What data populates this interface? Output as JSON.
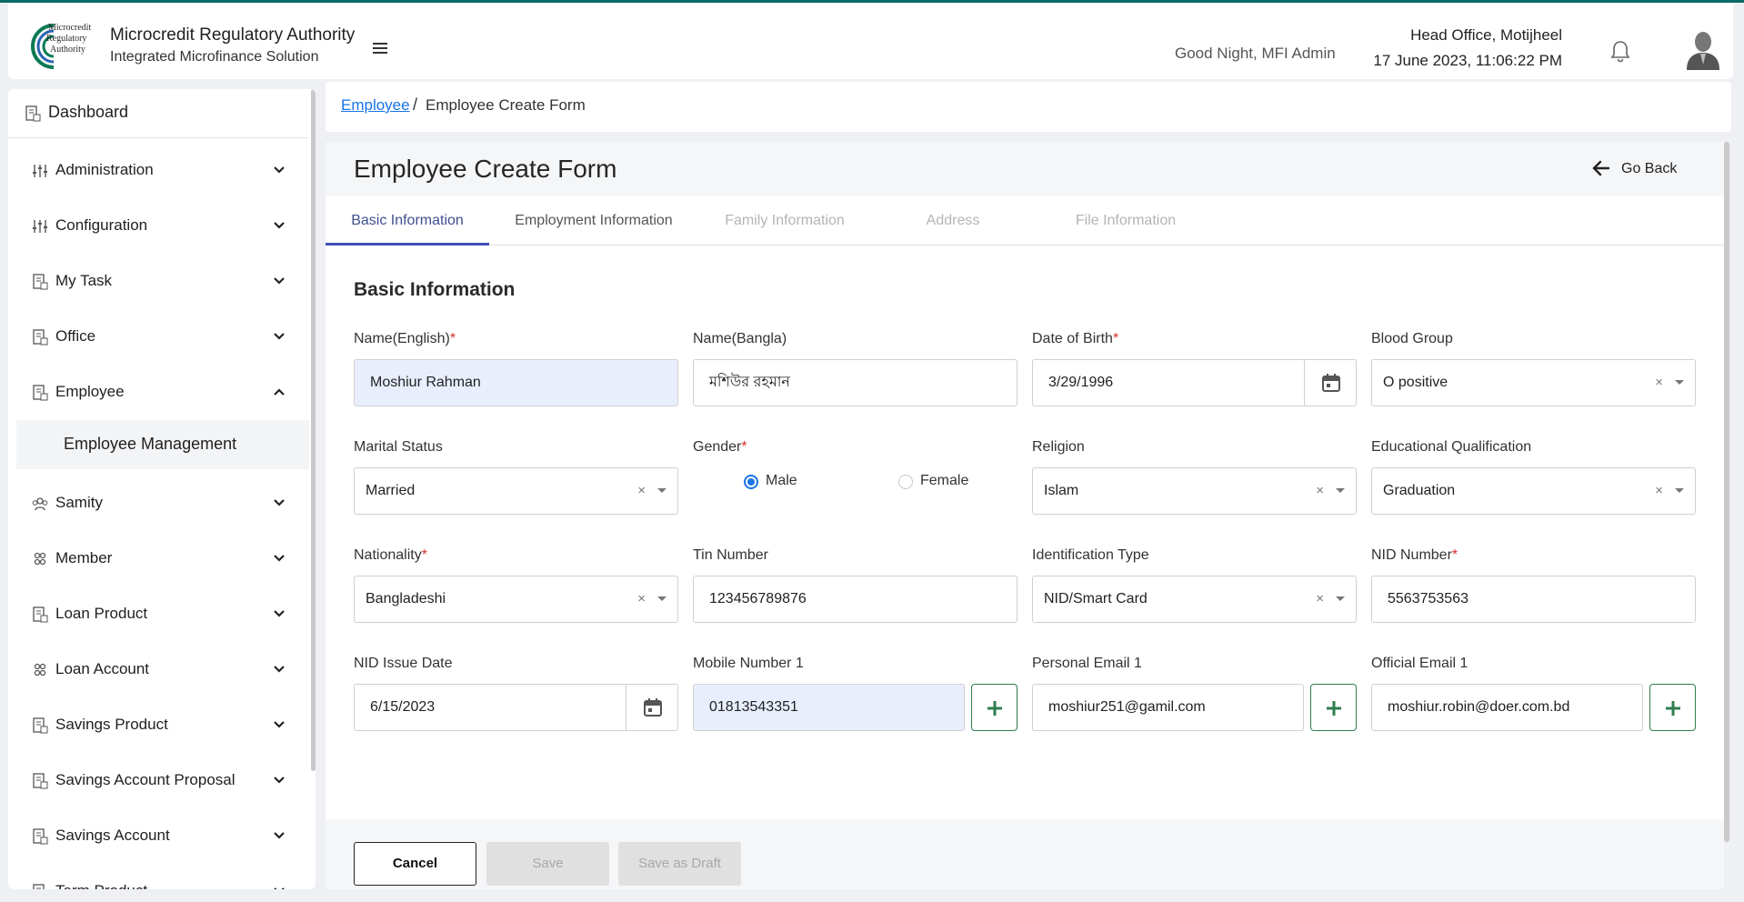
{
  "header": {
    "logo_text_lines": [
      "Microcredit",
      "Regulatory",
      "Authority"
    ],
    "org_title": "Microcredit Regulatory Authority",
    "org_subtitle": "Integrated Microfinance Solution",
    "greeting": "Good Night, MFI Admin",
    "office": "Head Office, Motijheel",
    "datetime": "17 June 2023, 11:06:22 PM",
    "brand_color": "#0b6b67"
  },
  "sidebar": {
    "dashboard": "Dashboard",
    "items": [
      {
        "label": "Administration",
        "icon": "sliders-icon",
        "expanded": false
      },
      {
        "label": "Configuration",
        "icon": "sliders-icon",
        "expanded": false
      },
      {
        "label": "My Task",
        "icon": "document-icon",
        "expanded": false
      },
      {
        "label": "Office",
        "icon": "document-icon",
        "expanded": false
      },
      {
        "label": "Employee",
        "icon": "document-icon",
        "expanded": true
      },
      {
        "label": "Samity",
        "icon": "group-icon",
        "expanded": false
      },
      {
        "label": "Member",
        "icon": "people-icon",
        "expanded": false
      },
      {
        "label": "Loan Product",
        "icon": "document-icon",
        "expanded": false
      },
      {
        "label": "Loan Account",
        "icon": "people-icon",
        "expanded": false
      },
      {
        "label": "Savings Product",
        "icon": "document-icon",
        "expanded": false
      },
      {
        "label": "Savings Account Proposal",
        "icon": "document-icon",
        "expanded": false
      },
      {
        "label": "Savings Account",
        "icon": "document-icon",
        "expanded": false
      },
      {
        "label": "Term Product",
        "icon": "document-icon",
        "expanded": false
      }
    ],
    "employee_subitem": "Employee Management"
  },
  "breadcrumb": {
    "parent": "Employee",
    "separator": "/",
    "current": "Employee Create Form"
  },
  "form": {
    "title": "Employee Create Form",
    "go_back": "Go Back",
    "tabs": [
      {
        "label": "Basic Information",
        "state": "active"
      },
      {
        "label": "Employment Information",
        "state": "normal"
      },
      {
        "label": "Family Information",
        "state": "disabled"
      },
      {
        "label": "Address",
        "state": "disabled"
      },
      {
        "label": "File Information",
        "state": "disabled"
      }
    ],
    "section_title": "Basic Information",
    "fields": {
      "name_english": {
        "label": "Name(English)",
        "value": "Moshiur Rahman"
      },
      "name_bangla": {
        "label": "Name(Bangla)",
        "value": "মশিউর রহমান"
      },
      "dob": {
        "label": "Date of Birth",
        "value": "3/29/1996"
      },
      "blood_group": {
        "label": "Blood Group",
        "value": "O positive"
      },
      "marital_status": {
        "label": "Marital Status",
        "value": "Married"
      },
      "gender": {
        "label": "Gender",
        "option_male": "Male",
        "option_female": "Female",
        "selected": "Male"
      },
      "religion": {
        "label": "Religion",
        "value": "Islam"
      },
      "education": {
        "label": "Educational Qualification",
        "value": "Graduation"
      },
      "nationality": {
        "label": "Nationality",
        "value": "Bangladeshi"
      },
      "tin": {
        "label": "Tin Number",
        "value": "123456789876"
      },
      "id_type": {
        "label": "Identification Type",
        "value": "NID/Smart Card"
      },
      "nid": {
        "label": "NID Number",
        "value": "5563753563"
      },
      "nid_issue": {
        "label": "NID Issue Date",
        "value": "6/15/2023"
      },
      "mobile1": {
        "label": "Mobile Number 1",
        "value": "01813543351"
      },
      "personal_email1": {
        "label": "Personal Email 1",
        "value": "moshiur251@gamil.com"
      },
      "official_email1": {
        "label": "Official Email 1",
        "value": "moshiur.robin@doer.com.bd"
      }
    },
    "required_mark": "*",
    "clear_mark": "×",
    "buttons": {
      "cancel": "Cancel",
      "save": "Save",
      "save_draft": "Save as Draft"
    }
  }
}
